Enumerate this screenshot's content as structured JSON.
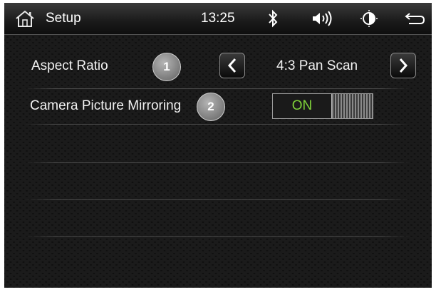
{
  "statusbar": {
    "title": "Setup",
    "time": "13:25",
    "icons": [
      "home-icon",
      "bluetooth-icon",
      "volume-icon",
      "brightness-icon",
      "back-icon"
    ]
  },
  "settings": {
    "aspect_ratio": {
      "label": "Aspect Ratio",
      "value": "4:3 Pan Scan",
      "badge": "1"
    },
    "mirroring": {
      "label": "Camera Picture Mirroring",
      "value": "ON",
      "badge": "2"
    }
  },
  "colors": {
    "toggle_on_text": "#7fd23a",
    "background": "#0d0d0d"
  }
}
